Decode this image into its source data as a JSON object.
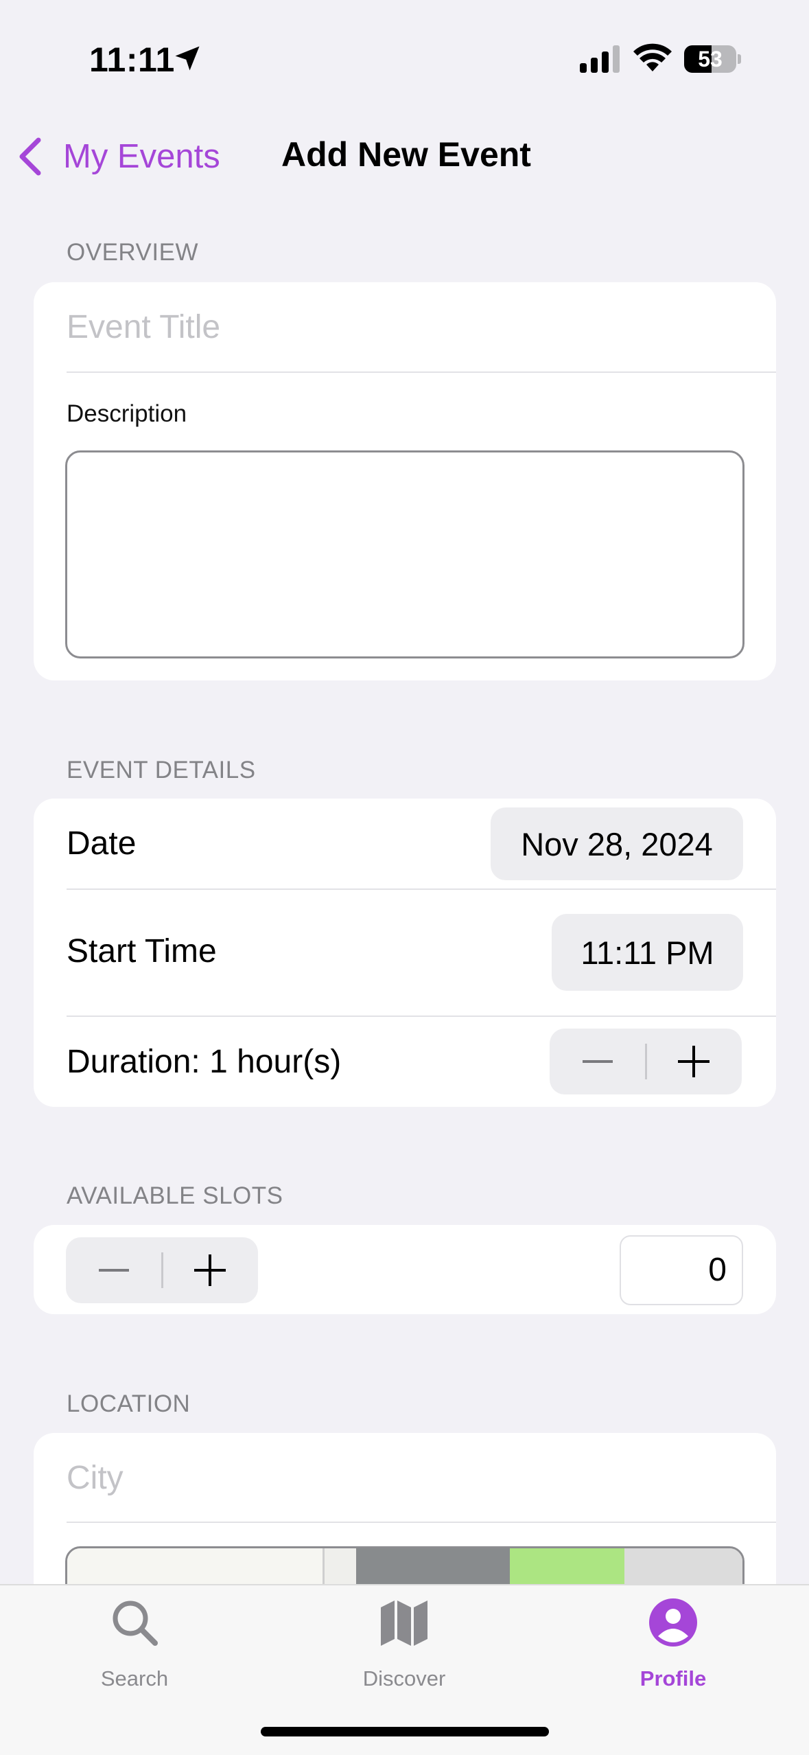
{
  "status_bar": {
    "time": "11:11",
    "battery_level": "53",
    "battery_fraction": 0.53
  },
  "nav": {
    "back_label": "My Events",
    "title": "Add New Event"
  },
  "overview": {
    "header": "OVERVIEW",
    "title_placeholder": "Event Title",
    "description_label": "Description"
  },
  "event_details": {
    "header": "EVENT DETAILS",
    "date_label": "Date",
    "date_value": "Nov 28, 2024",
    "start_time_label": "Start Time",
    "start_time_value": "11:11 PM",
    "duration_label": "Duration:  1 hour(s)",
    "minus": "—",
    "plus": "+"
  },
  "available_slots": {
    "header": "AVAILABLE SLOTS",
    "value": "0",
    "minus": "—",
    "plus": "+"
  },
  "location": {
    "header": "LOCATION",
    "city_placeholder": "City"
  },
  "tab_bar": {
    "tabs": [
      {
        "label": "Search",
        "icon": "search-icon",
        "active": false
      },
      {
        "label": "Discover",
        "icon": "map-icon",
        "active": false
      },
      {
        "label": "Profile",
        "icon": "profile-icon",
        "active": true
      }
    ]
  },
  "colors": {
    "accent": "#a546d8",
    "background": "#f2f1f6",
    "card": "#ffffff",
    "secondary_text": "#838387"
  }
}
